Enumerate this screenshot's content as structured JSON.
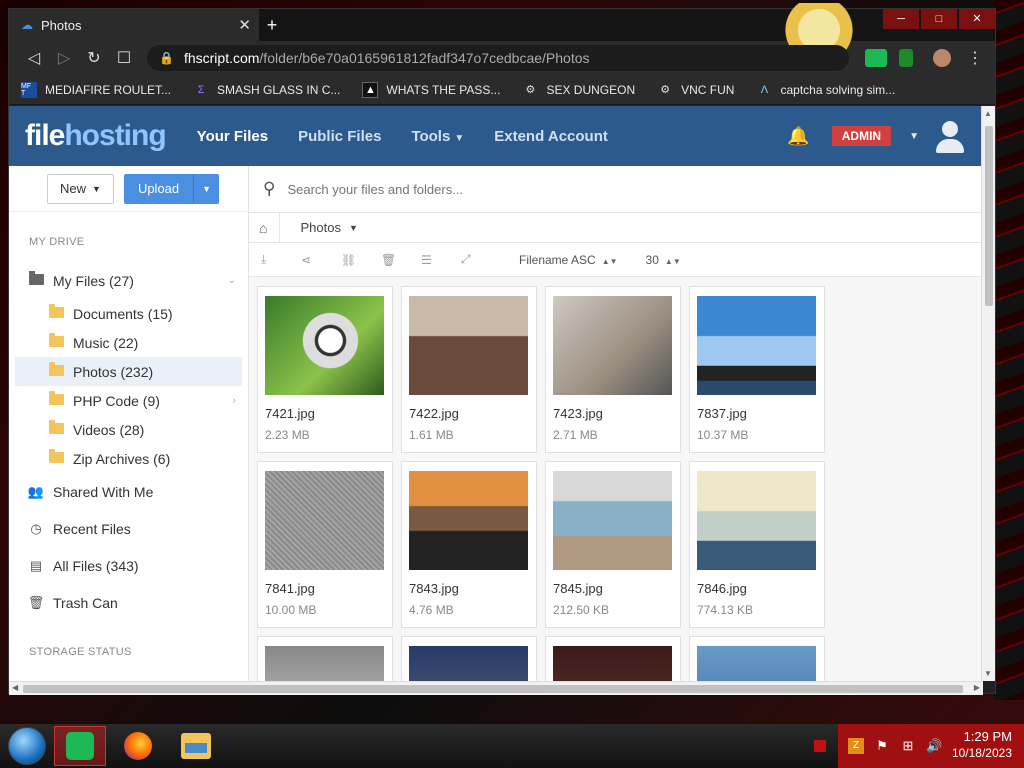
{
  "browser": {
    "tab_title": "Photos",
    "tab_close": "✕",
    "new_tab": "+",
    "url_host": "fhscript.com",
    "url_path": "/folder/b6e70a0165961812fadf347o7cedbcae/Photos",
    "bookmarks": [
      {
        "label": "MEDIAFIRE ROULET...",
        "icon": "mf",
        "glyph": "MF T"
      },
      {
        "label": "SMASH GLASS IN C...",
        "icon": "sg",
        "glyph": "Σ"
      },
      {
        "label": "WHATS THE PASS...",
        "icon": "wp",
        "glyph": "▲"
      },
      {
        "label": "SEX DUNGEON",
        "icon": "sd",
        "glyph": "⚙"
      },
      {
        "label": "VNC FUN",
        "icon": "vnc",
        "glyph": "⚙"
      },
      {
        "label": "captcha solving sim...",
        "icon": "cap",
        "glyph": "Λ"
      }
    ]
  },
  "header": {
    "logo_a": "file",
    "logo_b": "hosting",
    "nav": [
      {
        "label": "Your Files",
        "active": true,
        "caret": false
      },
      {
        "label": "Public Files",
        "active": false,
        "caret": false
      },
      {
        "label": "Tools",
        "active": false,
        "caret": true
      },
      {
        "label": "Extend Account",
        "active": false,
        "caret": false
      }
    ],
    "admin_label": "ADMIN"
  },
  "sidebar": {
    "new_label": "New",
    "upload_label": "Upload",
    "my_drive_heading": "MY DRIVE",
    "my_files": "My Files (27)",
    "folders": [
      {
        "label": "Documents (15)",
        "active": false,
        "chevron": false
      },
      {
        "label": "Music (22)",
        "active": false,
        "chevron": false
      },
      {
        "label": "Photos (232)",
        "active": true,
        "chevron": false
      },
      {
        "label": "PHP Code (9)",
        "active": false,
        "chevron": true
      },
      {
        "label": "Videos (28)",
        "active": false,
        "chevron": false
      },
      {
        "label": "Zip Archives (6)",
        "active": false,
        "chevron": false
      }
    ],
    "shared": "Shared With Me",
    "recent": "Recent Files",
    "all_files": "All Files (343)",
    "trash": "Trash Can",
    "storage_heading": "STORAGE STATUS"
  },
  "main": {
    "search_placeholder": "Search your files and folders...",
    "breadcrumb_current": "Photos",
    "sort_label": "Filename ASC",
    "per_page": "30",
    "files": [
      {
        "name": "7421.jpg",
        "size": "2.23 MB",
        "thumb": "t7421"
      },
      {
        "name": "7422.jpg",
        "size": "1.61 MB",
        "thumb": "t7422"
      },
      {
        "name": "7423.jpg",
        "size": "2.71 MB",
        "thumb": "t7423"
      },
      {
        "name": "7837.jpg",
        "size": "10.37 MB",
        "thumb": "t7837"
      },
      {
        "name": "7841.jpg",
        "size": "10.00 MB",
        "thumb": "t7841"
      },
      {
        "name": "7843.jpg",
        "size": "4.76 MB",
        "thumb": "t7843"
      },
      {
        "name": "7845.jpg",
        "size": "212.50 KB",
        "thumb": "t7845"
      },
      {
        "name": "7846.jpg",
        "size": "774.13 KB",
        "thumb": "t7846"
      }
    ]
  },
  "taskbar": {
    "time": "1:29 PM",
    "date": "10/18/2023"
  }
}
